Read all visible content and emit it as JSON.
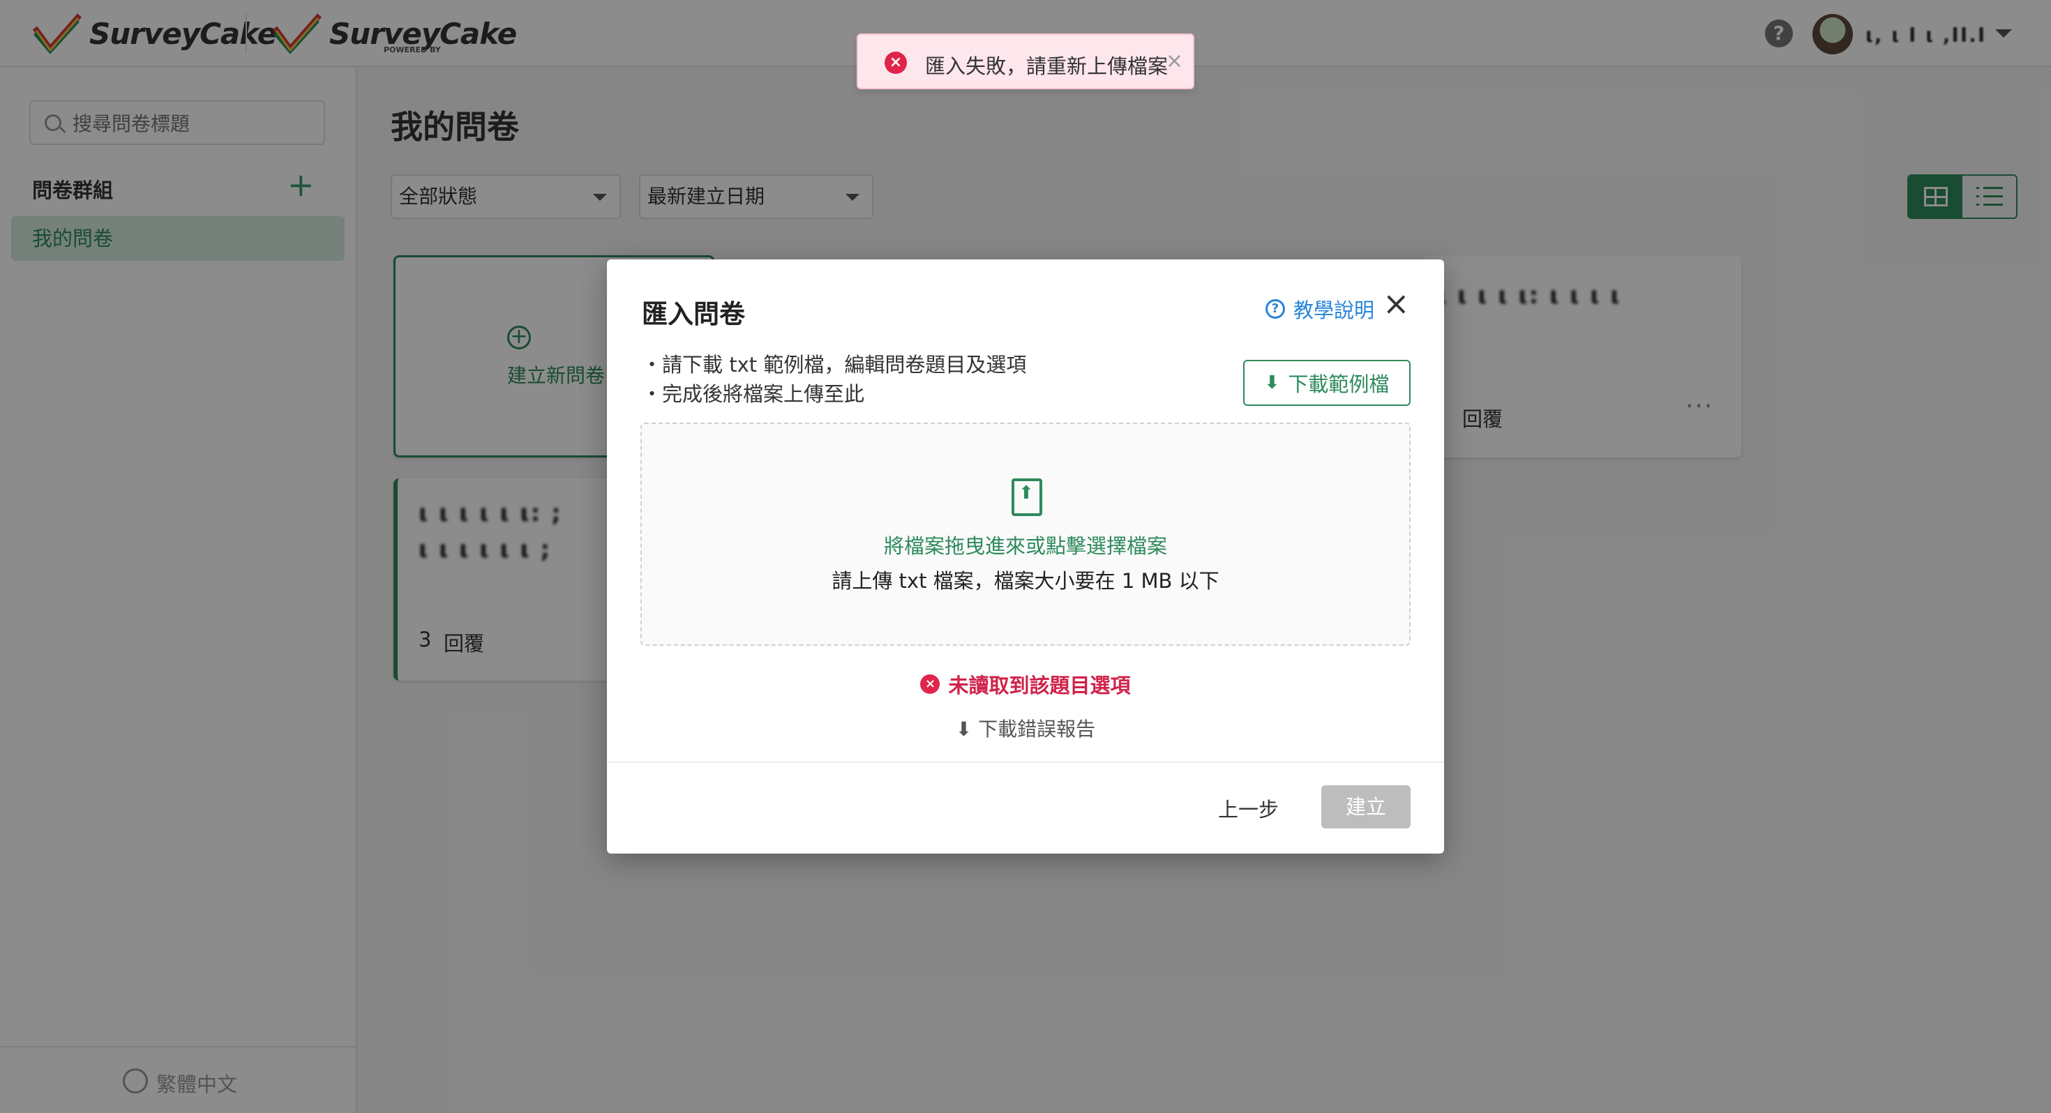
{
  "header": {
    "logo_1": "SurveyCake",
    "logo_2": "SurveyCake",
    "logo_2_sub": "POWERED BY",
    "help_icon": "question-circle-icon",
    "username": "ι, ι Ι ι ,ΙΙ.Ι"
  },
  "sidebar": {
    "search_placeholder": "搜尋問卷標題",
    "group_title": "問卷群組",
    "add_group": "+",
    "groups": [
      {
        "label": "我的問卷"
      }
    ],
    "language": "繁體中文"
  },
  "main": {
    "page_title": "我的問卷",
    "status_filter": "全部狀態",
    "sort_filter": "最新建立日期",
    "new_survey_label": "建立新問卷",
    "cards": [
      {
        "title": "ι ι ι ι ι: ι ι ι ι",
        "replies": "回覆",
        "reply_count": ")"
      },
      {
        "title": "ι ι ι ι ι ι: ;",
        "title_line2": "ι ι ι ι ι ι ;",
        "replies": "回覆",
        "reply_count": "3"
      }
    ],
    "more": "···"
  },
  "toast": {
    "icon": "error-circle-icon",
    "message": "匯入失敗，請重新上傳檔案",
    "close": "×"
  },
  "modal": {
    "title": "匯入問卷",
    "help_label": "教學說明",
    "close": "×",
    "instructions": [
      "・請下載 txt 範例檔，編輯問卷題目及選項",
      "・完成後將檔案上傳至此"
    ],
    "download_sample": "下載範例檔",
    "dropzone_primary": "將檔案拖曳進來或點擊選擇檔案",
    "dropzone_secondary": "請上傳 txt 檔案，檔案大小要在 1 MB 以下",
    "error_message": "未讀取到該題目選項",
    "download_report": "下載錯誤報告",
    "back_label": "上一步",
    "create_label": "建立"
  }
}
